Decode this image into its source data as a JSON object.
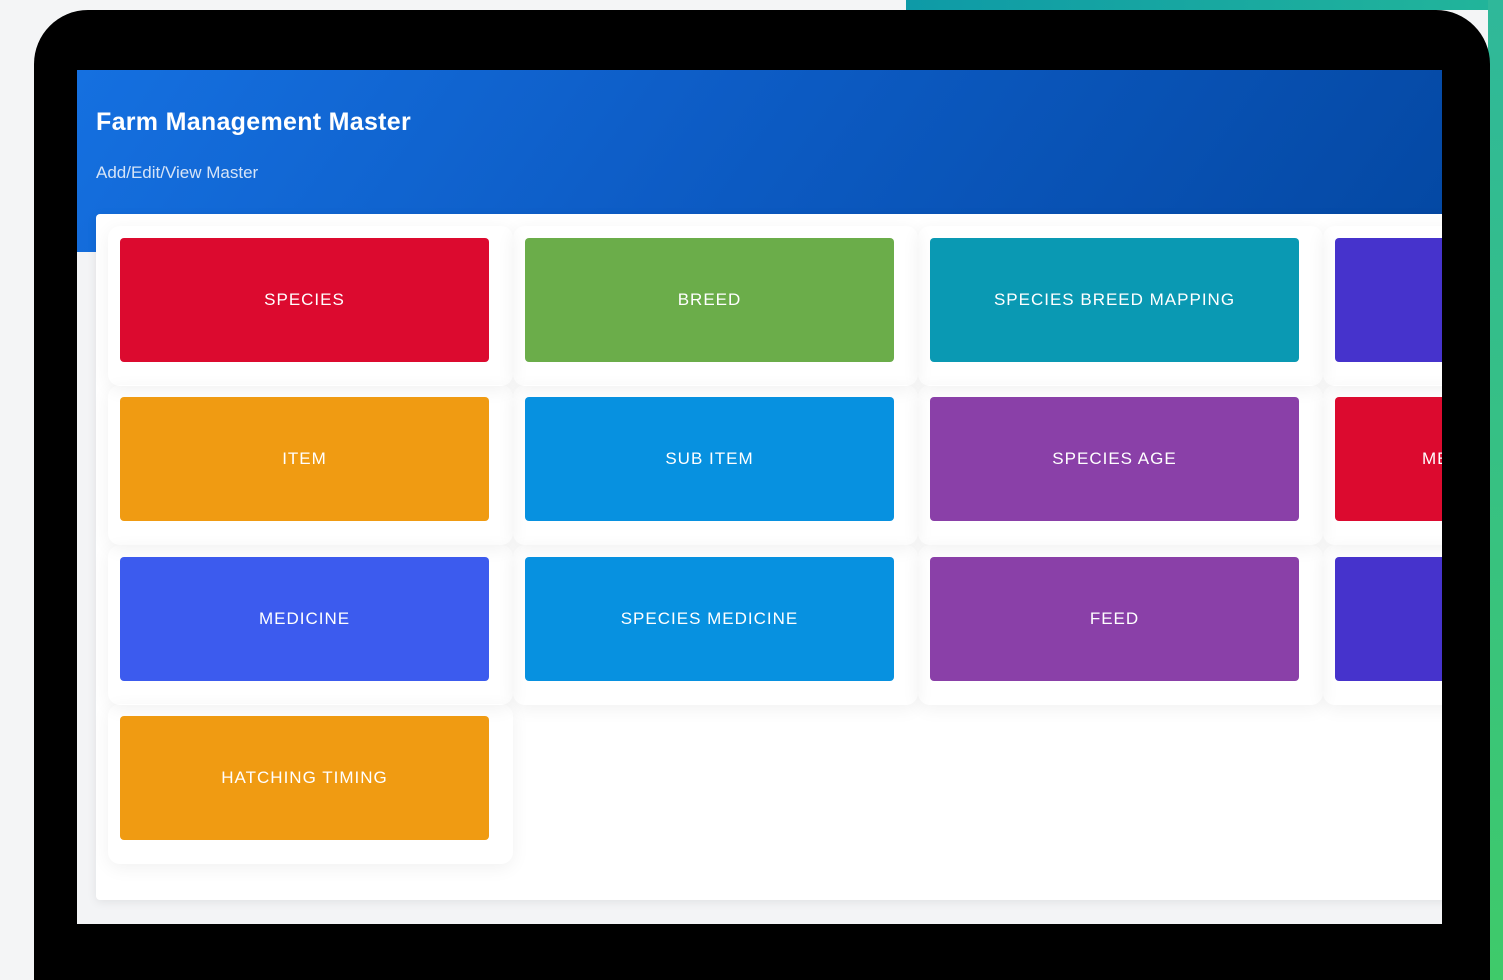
{
  "header": {
    "title": "Farm Management Master",
    "subtitle": "Add/Edit/View Master"
  },
  "tiles": [
    {
      "label": "SPECIES",
      "color": "#dc0a2f"
    },
    {
      "label": "BREED",
      "color": "#6bad4a"
    },
    {
      "label": "SPECIES BREED MAPPING",
      "color": "#0a99b3"
    },
    {
      "label": "",
      "color": "#4633cc"
    },
    {
      "label": "ITEM",
      "color": "#f09b12"
    },
    {
      "label": "SUB ITEM",
      "color": "#0791e0"
    },
    {
      "label": "SPECIES AGE",
      "color": "#8a40a8"
    },
    {
      "label": "ME",
      "color": "#dc0a2f"
    },
    {
      "label": "MEDICINE",
      "color": "#3c5bee"
    },
    {
      "label": "SPECIES MEDICINE",
      "color": "#0791e0"
    },
    {
      "label": "FEED",
      "color": "#8a40a8"
    },
    {
      "label": "",
      "color": "#4633cc"
    },
    {
      "label": "HATCHING TIMING",
      "color": "#f09b12"
    }
  ],
  "theme": {
    "header_gradient": [
      "#1570e0",
      "#0448a3"
    ],
    "bezel": "#000000",
    "accent": [
      "#0e9aa7",
      "#3fca6a"
    ]
  }
}
